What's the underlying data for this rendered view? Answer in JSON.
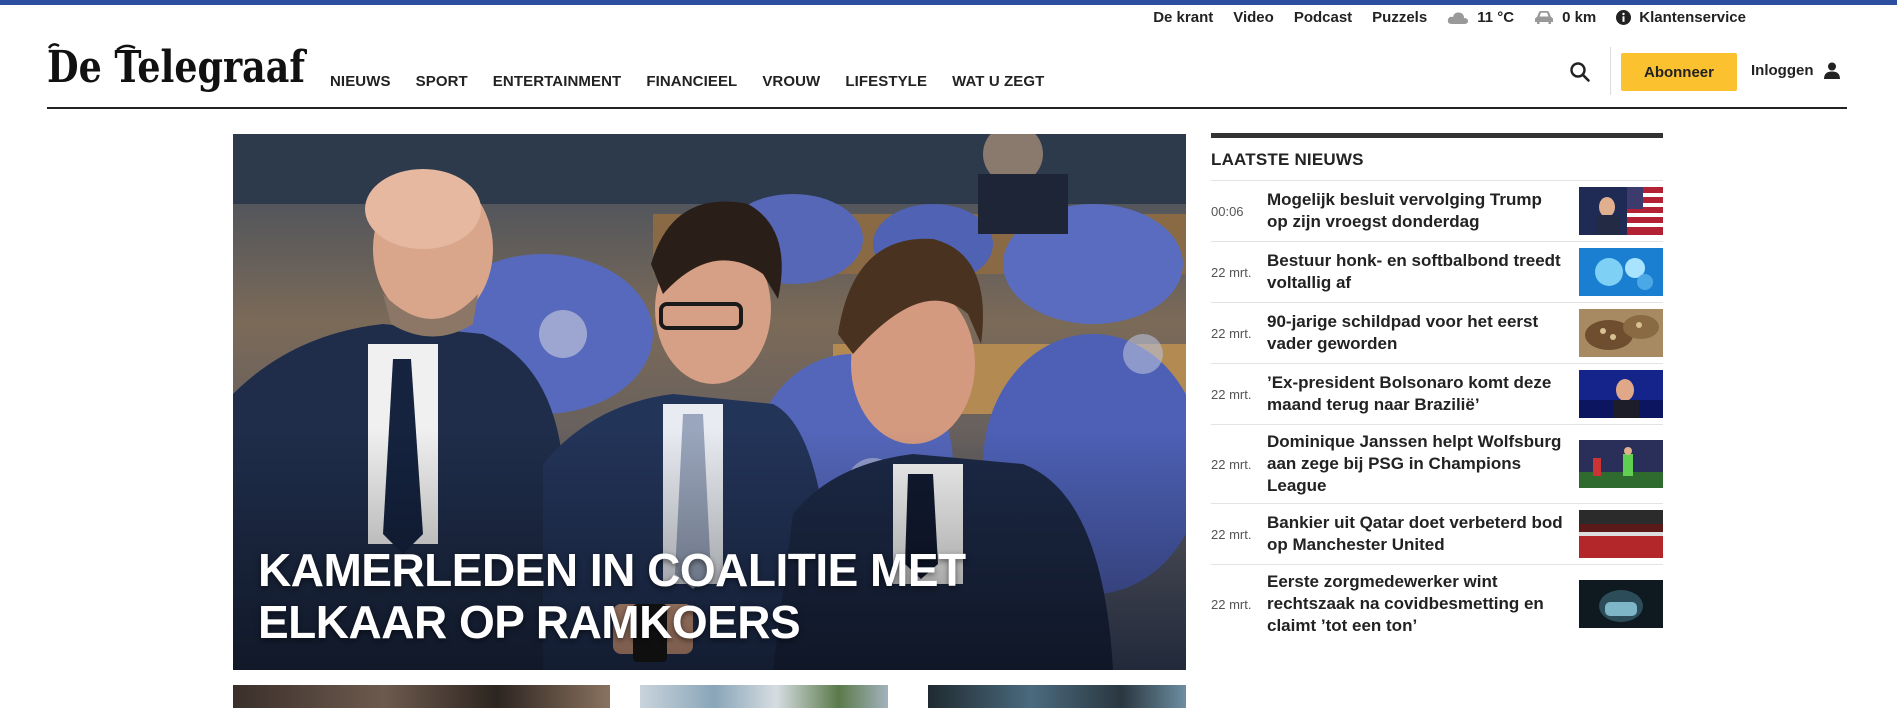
{
  "utility_nav": {
    "krant": "De krant",
    "video": "Video",
    "podcast": "Podcast",
    "puzzels": "Puzzels",
    "weather": "11 °C",
    "traffic": "0 km",
    "service": "Klantenservice"
  },
  "header": {
    "logo_text": "De Telegraaf",
    "nav": [
      "NIEUWS",
      "SPORT",
      "ENTERTAINMENT",
      "FINANCIEEL",
      "VROUW",
      "LIFESTYLE",
      "WAT U ZEGT"
    ],
    "subscribe": "Abonneer",
    "login": "Inloggen"
  },
  "hero": {
    "title": "KAMERLEDEN IN COALITIE MET ELKAAR OP RAMKOERS"
  },
  "latest": {
    "title": "LAATSTE NIEUWS",
    "items": [
      {
        "time": "00:06",
        "headline": "Mogelijk besluit vervolging Trump op zijn vroegst donderdag"
      },
      {
        "time": "22 mrt.",
        "headline": "Bestuur honk- en softbalbond treedt voltallig af"
      },
      {
        "time": "22 mrt.",
        "headline": "90-jarige schildpad voor het eerst vader geworden"
      },
      {
        "time": "22 mrt.",
        "headline": "’Ex-president Bolsonaro komt deze maand terug naar Brazilië’"
      },
      {
        "time": "22 mrt.",
        "headline": "Dominique Janssen helpt Wolfsburg aan zege bij PSG in Champions League"
      },
      {
        "time": "22 mrt.",
        "headline": "Bankier uit Qatar doet verbeterd bod op Manchester United"
      },
      {
        "time": "22 mrt.",
        "headline": "Eerste zorgmedewerker wint rechtszaak na covidbesmetting en claimt ’tot een ton’"
      }
    ]
  },
  "colors": {
    "accent_top": "#2b4f9e",
    "subscribe_bg": "#fcc12f",
    "text": "#222222"
  }
}
